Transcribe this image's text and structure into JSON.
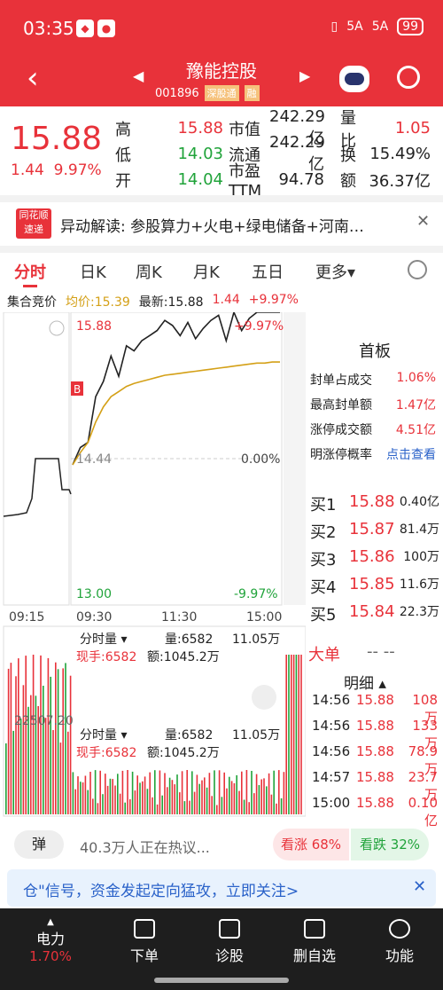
{
  "status": {
    "time": "03:35",
    "signal1": "5A",
    "signal2": "5A",
    "battery": "99"
  },
  "nav": {
    "title": "豫能控股",
    "code": "001896",
    "tag1": "深股通",
    "tag2": "融"
  },
  "quote": {
    "price": "15.88",
    "change": "1.44",
    "change_pct": "9.97%",
    "rows": [
      {
        "l1": "高",
        "v1": "15.88",
        "c1": "up",
        "l2": "市值",
        "v2": "242.29亿",
        "l3": "量比",
        "v3": "1.05",
        "c3": "up"
      },
      {
        "l1": "低",
        "v1": "14.03",
        "c1": "down",
        "l2": "流通",
        "v2": "242.29亿",
        "l3": "换",
        "v3": "15.49%",
        "c3": ""
      },
      {
        "l1": "开",
        "v1": "14.04",
        "c1": "down",
        "l2": "市盈TTM",
        "v2": "94.78",
        "l3": "额",
        "v3": "36.37亿",
        "c3": ""
      }
    ]
  },
  "news": {
    "logo_top": "同花顺",
    "logo_bottom": "速递",
    "text": "异动解读:  参股算力+火电+绿电储备+河南…"
  },
  "tabs": [
    "分时",
    "日K",
    "周K",
    "月K",
    "五日",
    "更多▾"
  ],
  "minute_header": {
    "auction": "集合竞价",
    "avg": "均价:15.39",
    "latest": "最新:15.88",
    "chg": "1.44",
    "pct": "+9.97%"
  },
  "chart_labels": {
    "top_price": "15.88",
    "top_pct": "+9.97%",
    "mid_price": "14.44",
    "mid_pct": "0.00%",
    "bot_price": "13.00",
    "bot_pct": "-9.97%",
    "t1": "09:15",
    "t2": "09:30",
    "t3": "11:30",
    "t4": "15:00",
    "marker": "B",
    "vol_left": "22507.20"
  },
  "side": {
    "title": "首板",
    "rows": [
      {
        "k": "封单占成交",
        "v": "1.06%"
      },
      {
        "k": "最高封单额",
        "v": "1.47亿"
      },
      {
        "k": "涨停成交额",
        "v": "4.51亿"
      },
      {
        "k": "明涨停概率",
        "v": "点击查看"
      }
    ]
  },
  "book": [
    {
      "k": "买1",
      "p": "15.88",
      "q": "0.40亿"
    },
    {
      "k": "买2",
      "p": "15.87",
      "q": "81.4万"
    },
    {
      "k": "买3",
      "p": "15.86",
      "q": "100万"
    },
    {
      "k": "买4",
      "p": "15.85",
      "q": "11.6万"
    },
    {
      "k": "买5",
      "p": "15.84",
      "q": "22.3万"
    }
  ],
  "big_order": {
    "label": "大单",
    "value": "-- --"
  },
  "detail": {
    "title": "明细 ▴",
    "rows": [
      {
        "t": "14:56",
        "p": "15.88",
        "q": "108万"
      },
      {
        "t": "14:56",
        "p": "15.88",
        "q": "133万"
      },
      {
        "t": "14:56",
        "p": "15.88",
        "q": "78.9万"
      },
      {
        "t": "14:57",
        "p": "15.88",
        "q": "23.7万"
      },
      {
        "t": "15:00",
        "p": "15.88",
        "q": "0.10亿"
      }
    ]
  },
  "volume_panels": [
    {
      "title": "分时量 ▾",
      "vol": "量:6582",
      "max": "11.05万",
      "hand": "现手:6582",
      "amt": "额:1045.2万"
    },
    {
      "title": "分时量 ▾",
      "vol": "量:6582",
      "max": "11.05万",
      "hand": "现手:6582",
      "amt": "额:1045.2万"
    }
  ],
  "heat": {
    "icon": "弹",
    "text": "40.3万人正在热议...",
    "up": "看涨 68%",
    "down": "看跌 32%"
  },
  "banner": {
    "text": "仓\"信号，资金发起定向猛攻，立即关注>"
  },
  "bottom": [
    {
      "label": "电力",
      "pct": "1.70%"
    },
    {
      "label": "下单"
    },
    {
      "label": "诊股"
    },
    {
      "label": "删自选"
    },
    {
      "label": "功能"
    }
  ],
  "colors": {
    "up": "#e8323a",
    "down": "#20a33a",
    "avg": "#d4a017"
  },
  "chart_data": {
    "type": "line",
    "title": "",
    "xlabel": "",
    "ylabel": "",
    "ylim": [
      13.0,
      15.88
    ],
    "x": [
      "09:15",
      "09:25",
      "09:30",
      "09:35",
      "09:40",
      "09:50",
      "10:00",
      "10:10",
      "10:20",
      "10:30",
      "10:40",
      "10:50",
      "11:00",
      "11:10",
      "11:20",
      "11:30",
      "13:10",
      "13:20",
      "13:30",
      "13:40",
      "13:50",
      "14:00",
      "14:10",
      "14:20",
      "14:30",
      "14:40",
      "14:50",
      "15:00"
    ],
    "series": [
      {
        "values": [
          14.38,
          14.55,
          14.6,
          15.05,
          15.2,
          15.45,
          15.25,
          15.55,
          15.5,
          15.6,
          15.65,
          15.7,
          15.8,
          15.75,
          15.65,
          15.78,
          15.62,
          15.72,
          15.8,
          15.85,
          15.6,
          15.88,
          15.7,
          15.82,
          15.88,
          15.88,
          15.88,
          15.88
        ]
      },
      {
        "values": [
          14.38,
          14.5,
          14.6,
          14.8,
          14.95,
          15.05,
          15.1,
          15.15,
          15.18,
          15.2,
          15.22,
          15.24,
          15.26,
          15.27,
          15.28,
          15.29,
          15.3,
          15.31,
          15.32,
          15.33,
          15.34,
          15.35,
          15.36,
          15.37,
          15.38,
          15.38,
          15.39,
          15.39
        ]
      }
    ]
  }
}
